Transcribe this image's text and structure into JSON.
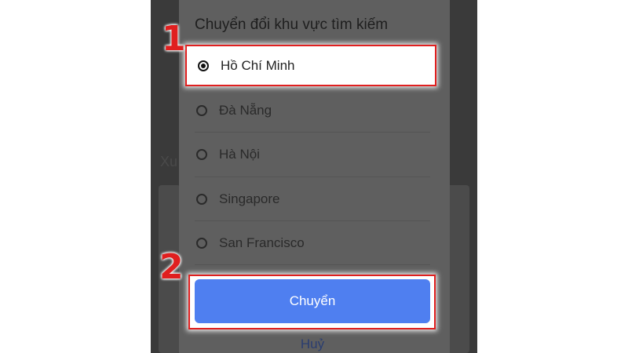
{
  "dialog": {
    "title": "Chuyển đổi khu vực tìm kiếm",
    "options": [
      {
        "label": "Hồ Chí Minh",
        "selected": true
      },
      {
        "label": "Đà Nẵng",
        "selected": false
      },
      {
        "label": "Hà Nội",
        "selected": false
      },
      {
        "label": "Singapore",
        "selected": false
      },
      {
        "label": "San Francisco",
        "selected": false
      }
    ],
    "confirm_label": "Chuyển",
    "cancel_label": "Huỷ"
  },
  "background": {
    "partial_text": "Xu"
  },
  "annotations": {
    "step1": "1",
    "step2": "2"
  },
  "colors": {
    "primary_button": "#4f7ff0",
    "highlight_border": "#e01f1f"
  }
}
